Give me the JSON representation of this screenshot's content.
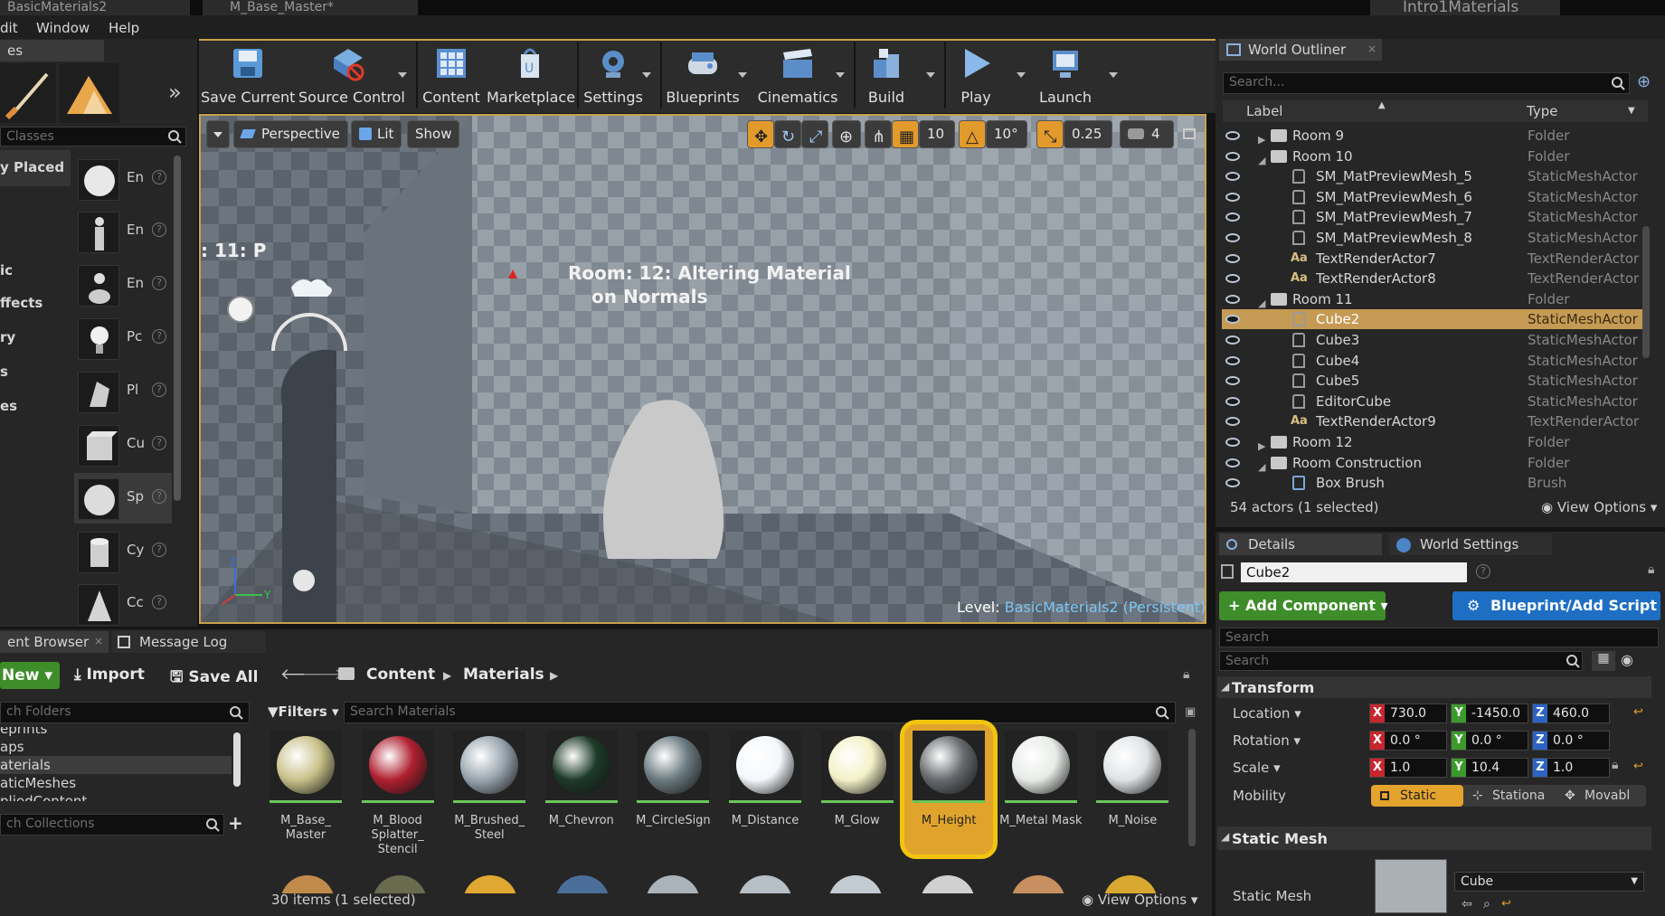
{
  "tabs": {
    "doc1": "BasicMaterials2",
    "doc2": "M_Base_Master*",
    "project": "Intro1Materials"
  },
  "menu": {
    "edit": "dit",
    "window": "Window",
    "help": "Help"
  },
  "modes": {
    "tab": "es",
    "search": "Classes",
    "categories": [
      "y Placed",
      "ic",
      "ffects",
      "ry",
      "s",
      "es"
    ],
    "items": [
      {
        "label": "En",
        "icon": "sphere-icon"
      },
      {
        "label": "En",
        "icon": "character-icon"
      },
      {
        "label": "En",
        "icon": "pawn-icon"
      },
      {
        "label": "Pc",
        "icon": "point-light-icon"
      },
      {
        "label": "Pl",
        "icon": "player-start-icon"
      },
      {
        "label": "Cu",
        "icon": "cube-icon"
      },
      {
        "label": "Sp",
        "icon": "sphere-icon"
      },
      {
        "label": "Cy",
        "icon": "cylinder-icon"
      },
      {
        "label": "Cc",
        "icon": "cone-icon"
      }
    ]
  },
  "toolbar": {
    "save": "Save Current",
    "source": "Source Control",
    "content": "Content",
    "marketplace": "Marketplace",
    "settings": "Settings",
    "blueprints": "Blueprints",
    "cinematics": "Cinematics",
    "build": "Build",
    "play": "Play",
    "launch": "Launch"
  },
  "viewport": {
    "perspective": "Perspective",
    "lit": "Lit",
    "show": "Show",
    "grid": "10",
    "angle": "10°",
    "scale": "0.25",
    "speed": "4",
    "room11": ": 11: P",
    "room_text_1": "Room: 12: Altering Material",
    "room_text_2": "on Normals",
    "level_label": "Level:",
    "level_name": "BasicMaterials2 (Persistent)"
  },
  "outliner": {
    "tab": "World Outliner",
    "search": "Search...",
    "col_label": "Label",
    "col_type": "Type",
    "rows": [
      {
        "label": "Room 9",
        "type": "Folder",
        "kind": "folder",
        "depth": 0,
        "exp": "▶"
      },
      {
        "label": "Room 10",
        "type": "Folder",
        "kind": "folder",
        "depth": 0,
        "exp": "◢"
      },
      {
        "label": "SM_MatPreviewMesh_5",
        "type": "StaticMeshActor",
        "kind": "mesh",
        "depth": 1
      },
      {
        "label": "SM_MatPreviewMesh_6",
        "type": "StaticMeshActor",
        "kind": "mesh",
        "depth": 1
      },
      {
        "label": "SM_MatPreviewMesh_7",
        "type": "StaticMeshActor",
        "kind": "mesh",
        "depth": 1
      },
      {
        "label": "SM_MatPreviewMesh_8",
        "type": "StaticMeshActor",
        "kind": "mesh",
        "depth": 1
      },
      {
        "label": "TextRenderActor7",
        "type": "TextRenderActor",
        "kind": "text",
        "depth": 1
      },
      {
        "label": "TextRenderActor8",
        "type": "TextRenderActor",
        "kind": "text",
        "depth": 1
      },
      {
        "label": "Room 11",
        "type": "Folder",
        "kind": "folder",
        "depth": 0,
        "exp": "◢"
      },
      {
        "label": "Cube2",
        "type": "StaticMeshActor",
        "kind": "mesh",
        "depth": 1,
        "selected": true
      },
      {
        "label": "Cube3",
        "type": "StaticMeshActor",
        "kind": "mesh",
        "depth": 1
      },
      {
        "label": "Cube4",
        "type": "StaticMeshActor",
        "kind": "mesh",
        "depth": 1
      },
      {
        "label": "Cube5",
        "type": "StaticMeshActor",
        "kind": "mesh",
        "depth": 1
      },
      {
        "label": "EditorCube",
        "type": "StaticMeshActor",
        "kind": "mesh",
        "depth": 1
      },
      {
        "label": "TextRenderActor9",
        "type": "TextRenderActor",
        "kind": "text",
        "depth": 1
      },
      {
        "label": "Room 12",
        "type": "Folder",
        "kind": "folder",
        "depth": 0,
        "exp": "▶"
      },
      {
        "label": "Room Construction",
        "type": "Folder",
        "kind": "folder",
        "depth": 0,
        "exp": "◢"
      },
      {
        "label": "Box Brush",
        "type": "Brush",
        "kind": "brush",
        "depth": 1
      }
    ],
    "status": "54 actors (1 selected)",
    "view_options": "View Options"
  },
  "details": {
    "tab": "Details",
    "tab2": "World Settings",
    "name": "Cube2",
    "add_component": "+ Add Component",
    "blueprint": "Blueprint/Add Script",
    "search1": "Search",
    "search2": "Search",
    "transform": "Transform",
    "location": "Location",
    "rotation": "Rotation",
    "scale": "Scale",
    "mobility": "Mobility",
    "loc": [
      "730.0",
      "-1450.0",
      "460.0"
    ],
    "rot": [
      "0.0 °",
      "0.0 °",
      "0.0 °"
    ],
    "scl": [
      "1.0",
      "10.4",
      "1.0"
    ],
    "mob": [
      "Static",
      "Stationa",
      "Movabl"
    ],
    "static_mesh_section": "Static Mesh",
    "static_mesh_label": "Static Mesh",
    "mesh_value": "Cube"
  },
  "content_browser": {
    "tab": "ent Browser",
    "tab2": "Message Log",
    "new": "New",
    "import": "Import",
    "save_all": "Save All",
    "path": [
      "Content",
      "Materials"
    ],
    "search_folders": "ch Folders",
    "folders": [
      "eprints",
      "aps",
      "aterials",
      "aticMeshes",
      "pliedContent"
    ],
    "search_collections": "ch Collections",
    "filters": "Filters",
    "search_materials": "Search Materials",
    "assets": [
      {
        "name": "M_Base_ Master",
        "color": "#c9c18a"
      },
      {
        "name": "M_Blood Splatter_ Stencil",
        "color": "#b02030"
      },
      {
        "name": "M_Brushed_ Steel",
        "color": "#9aa6b0"
      },
      {
        "name": "M_Chevron",
        "color": "#1d3a28"
      },
      {
        "name": "M_CircleSign",
        "color": "#6a7a80"
      },
      {
        "name": "M_Distance",
        "color": "#f4f8fc"
      },
      {
        "name": "M_Glow",
        "color": "#f4f1c8"
      },
      {
        "name": "M_Height",
        "color": "#666a6e",
        "selected": true
      },
      {
        "name": "M_Metal Mask",
        "color": "#e8ece8"
      },
      {
        "name": "M_Noise",
        "color": "#e0e3e6"
      }
    ],
    "status": "30 items (1 selected)",
    "view_options": "View Options"
  },
  "colors": {
    "accent": "#f1c40f",
    "selected_row": "#c49a55",
    "panel": "#262626",
    "add_component": "#3e8d2a",
    "blueprint_btn": "#1e6fc4"
  }
}
